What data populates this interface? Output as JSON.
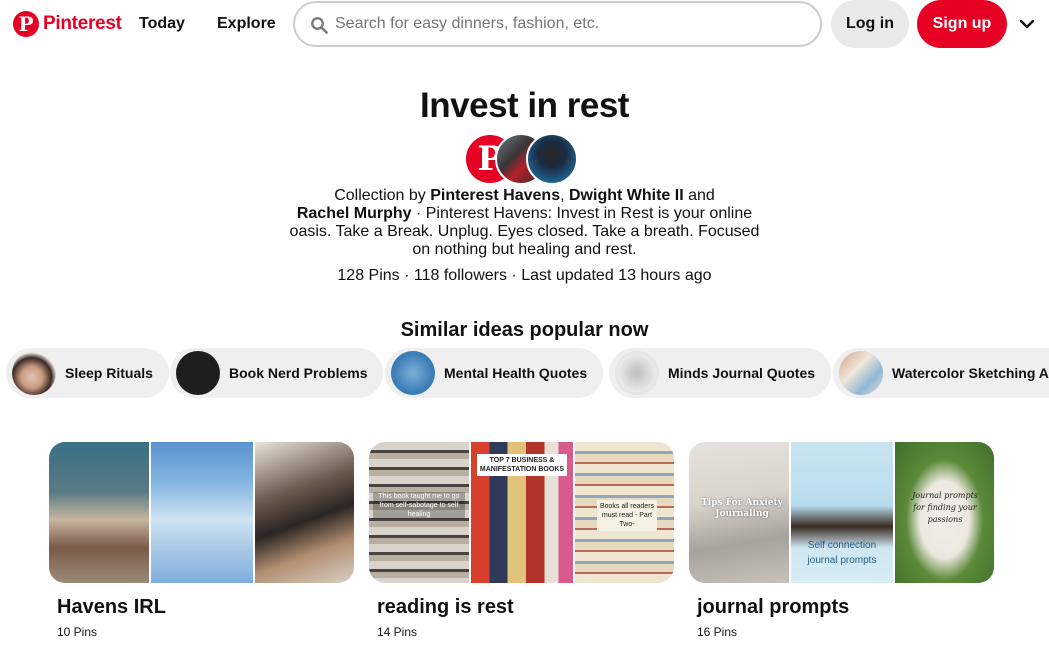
{
  "header": {
    "logo_text": "Pinterest",
    "nav": [
      "Today",
      "Explore"
    ],
    "search_placeholder": "Search for easy dinners, fashion, etc.",
    "login_label": "Log in",
    "signup_label": "Sign up",
    "accent_color": "#e60023"
  },
  "collection": {
    "title": "Invest in rest",
    "by_prefix": "Collection by",
    "author1": "Pinterest Havens",
    "comma": ",",
    "author2": "Dwight White II",
    "and": "and",
    "author3": "Rachel Murphy",
    "description": "· Pinterest Havens: Invest in Rest is your online oasis. Take a Break. Unplug. Eyes closed. Take a breath. Focused on nothing but healing and rest.",
    "stats": "128 Pins · 118 followers · Last updated 13 hours ago"
  },
  "similar": {
    "heading": "Similar ideas popular now",
    "chips": [
      {
        "label": "Sleep Rituals"
      },
      {
        "label": "Book Nerd Problems"
      },
      {
        "label": "Mental Health Quotes"
      },
      {
        "label": "Minds Journal Quotes"
      },
      {
        "label": "Watercolor Sketching A"
      }
    ]
  },
  "boards": [
    {
      "title": "Havens IRL",
      "count": "10 Pins",
      "texts": []
    },
    {
      "title": "reading is rest",
      "count": "14 Pins",
      "texts": [
        "This book taught me to go from self-sabotage to self healing",
        "TOP 7 BUSINESS & MANIFESTATION BOOKS",
        "Books all readers must read - Part Two-"
      ]
    },
    {
      "title": "journal prompts",
      "count": "16 Pins",
      "texts": [
        "Tips For Anxiety Journaling",
        "Self connection journal prompts",
        "Journal prompts for finding your passions"
      ]
    }
  ]
}
